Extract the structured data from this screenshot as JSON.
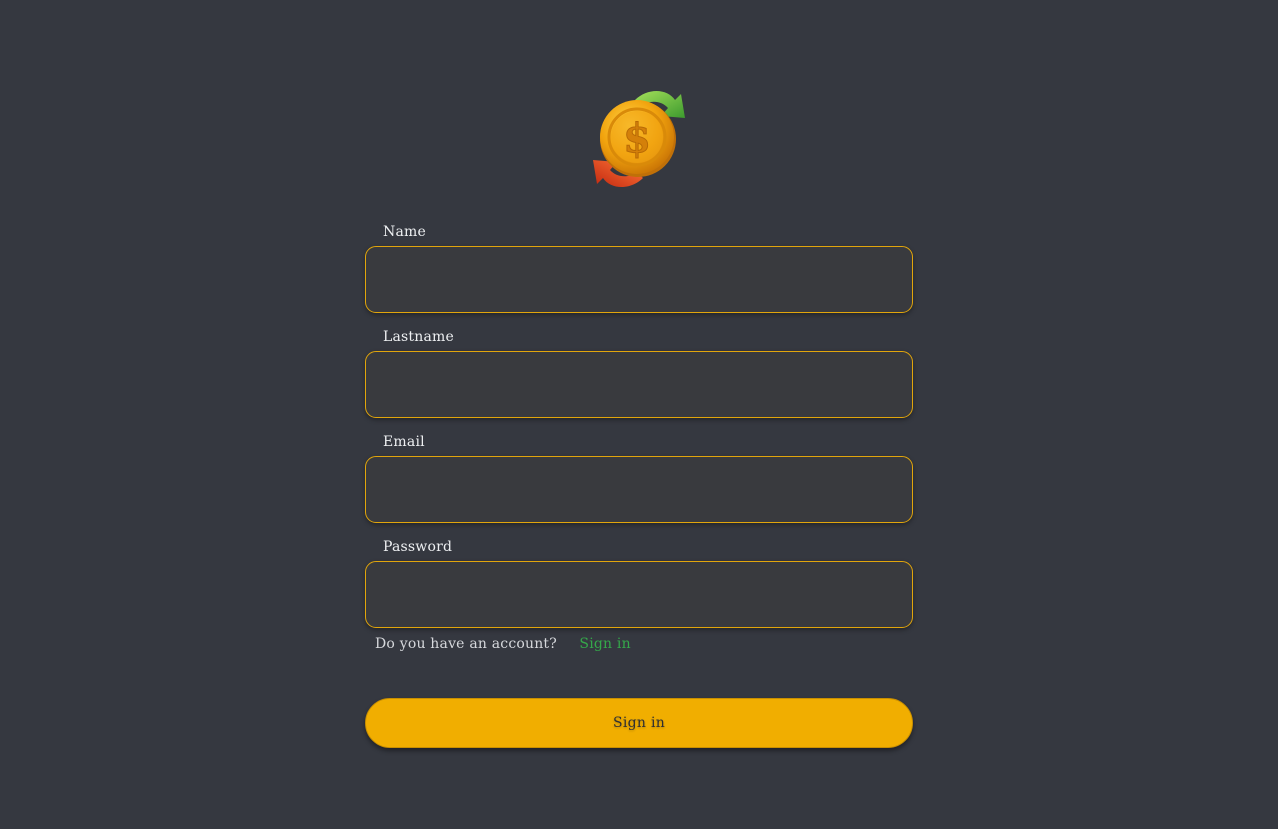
{
  "logo": {
    "icon": "currency-exchange-coin-icon",
    "symbol": "$"
  },
  "form": {
    "fields": [
      {
        "label": "Name",
        "value": "",
        "placeholder": ""
      },
      {
        "label": "Lastname",
        "value": "",
        "placeholder": ""
      },
      {
        "label": "Email",
        "value": "",
        "placeholder": ""
      },
      {
        "label": "Password",
        "value": "",
        "placeholder": ""
      }
    ],
    "account_question": "Do you have an account?",
    "account_link": "Sign in",
    "submit_label": "Sign in"
  },
  "colors": {
    "background": "#353840",
    "accent": "#f1ae00",
    "input_border": "#e1a50c",
    "link": "#35a84a"
  }
}
